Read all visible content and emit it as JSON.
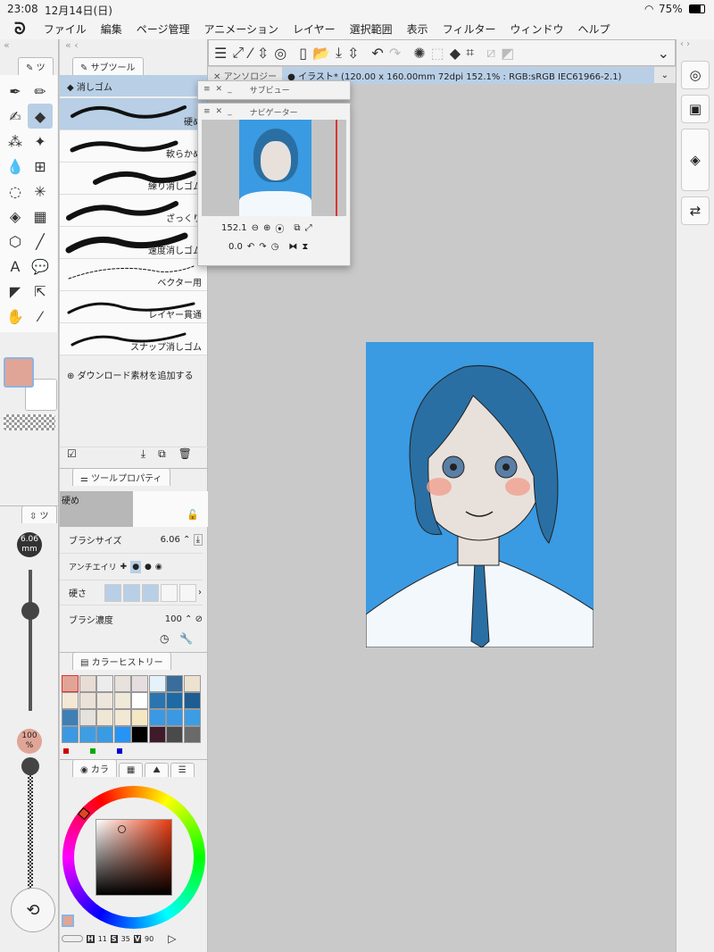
{
  "status": {
    "time": "23:08",
    "date": "12月14日(日)",
    "battery": "75%"
  },
  "menu": [
    "ファイル",
    "編集",
    "ページ管理",
    "アニメーション",
    "レイヤー",
    "選択範囲",
    "表示",
    "フィルター",
    "ウィンドウ",
    "ヘルプ"
  ],
  "tool_tab": "ツ",
  "subtool": {
    "tab": "サブツール",
    "group": "消しゴム",
    "brushes": [
      "硬め",
      "軟らかめ",
      "練り消しゴム",
      "ざっくり",
      "速度消しゴム",
      "ベクター用",
      "レイヤー貫通",
      "スナップ消しゴム"
    ],
    "add_label": "ダウンロード素材を追加する"
  },
  "toolprop": {
    "tab": "ツールプロパティ",
    "preview_label": "硬め",
    "brush_size_label": "ブラシサイズ",
    "brush_size": "6.06",
    "antialias_label": "アンチエイリ",
    "hardness_label": "硬さ",
    "density_label": "ブラシ濃度",
    "density": "100",
    "hardness_level": 3
  },
  "size_readout": {
    "value": "6.06",
    "unit": "mm"
  },
  "opacity_readout": {
    "value": "100",
    "unit": "%"
  },
  "history": {
    "tab": "カラーヒストリー",
    "colors": [
      "#e0a597",
      "#e8ddd4",
      "#ececec",
      "#e8e2dc",
      "#e6dde0",
      "#e6f2fb",
      "#3a6d9a",
      "#ede1cf",
      "#f3e7d6",
      "#eae2d8",
      "#eee6dd",
      "#f0e8d8",
      "#ffffff",
      "#2a74b0",
      "#1d6aa5",
      "#1d5d91",
      "#3e7fb5",
      "#e5e1dc",
      "#f0e6d6",
      "#f2e8d4",
      "#f5e6c4",
      "#3a99e2",
      "#3a99e2",
      "#3c9de4",
      "#3a99e2",
      "#3e9ee3",
      "#3a9ae2",
      "#2793f5",
      "#000000",
      "#3f1a2a",
      "#4a4a4a",
      "#6a6a6a"
    ]
  },
  "colorwheel": {
    "tab": "カラ",
    "h": "11",
    "s": "35",
    "v": "90",
    "main_color": "#e0a597"
  },
  "doc_tabs": {
    "other": "アンソロジー",
    "active": "● イラスト* (120.00 x 160.00mm 72dpi 152.1% : RGB:sRGB IEC61966-2.1)"
  },
  "subview": {
    "title": "サブビュー"
  },
  "navigator": {
    "title": "ナビゲーター",
    "zoom": "152.1",
    "rotation": "0.0"
  },
  "colors": {
    "canvas_bg": "#3a9ae2",
    "hair": "#2a6fa3",
    "accent": "#b8cfe6"
  }
}
